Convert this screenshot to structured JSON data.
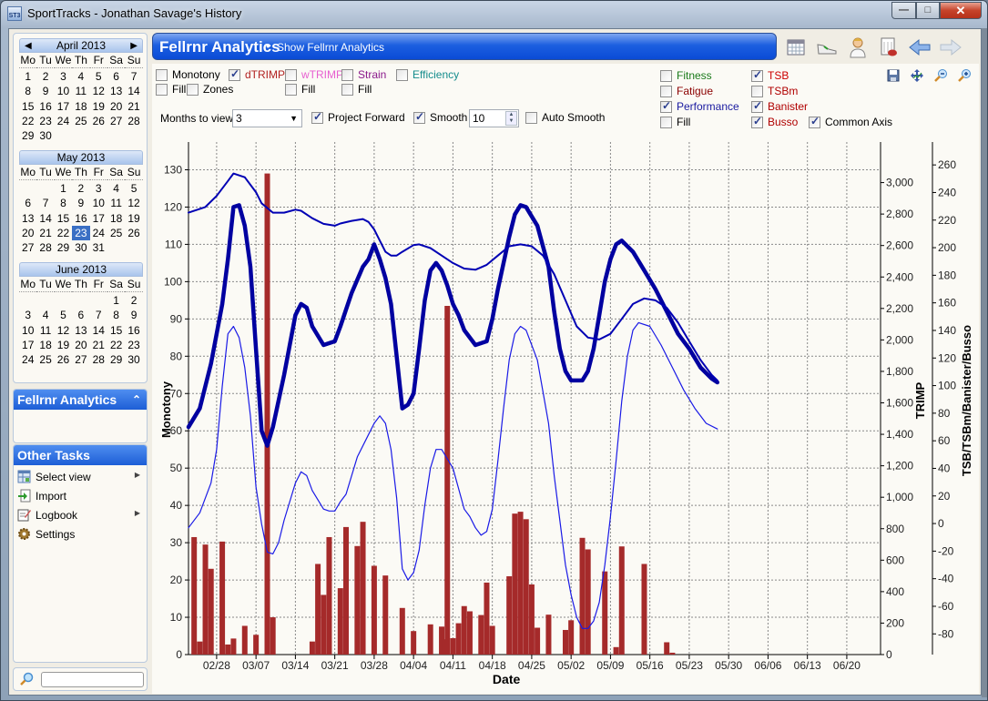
{
  "window": {
    "title": "SportTracks - Jonathan Savage's History",
    "app_icon_text": "ST3",
    "buttons": {
      "minimize": "—",
      "maximize": "□",
      "close": "✕"
    }
  },
  "calendars": [
    {
      "title": "April 2013",
      "nav_prev": "◀",
      "nav_next": "▶",
      "lead": 0,
      "days": 30,
      "selected": null
    },
    {
      "title": "May 2013",
      "lead": 2,
      "days": 31,
      "selected": 23
    },
    {
      "title": "June 2013",
      "lead": 5,
      "days": 30,
      "selected": null
    }
  ],
  "weekdays": [
    "Mo",
    "Tu",
    "We",
    "Th",
    "Fr",
    "Sa",
    "Su"
  ],
  "sidebar": {
    "analytics_panel": {
      "title": "Fellrnr Analytics",
      "collapse_icon": "«"
    },
    "other_tasks": {
      "title": "Other Tasks",
      "items": [
        {
          "label": "Select view",
          "icon": "select-view-icon",
          "submenu": true
        },
        {
          "label": "Import",
          "icon": "import-icon",
          "submenu": false
        },
        {
          "label": "Logbook",
          "icon": "logbook-icon",
          "submenu": true
        },
        {
          "label": "Settings",
          "icon": "gear-icon",
          "submenu": false
        }
      ]
    },
    "search": {
      "value": "",
      "placeholder": ""
    }
  },
  "header": {
    "title": "Fellrnr Analytics",
    "bullet": "•",
    "subtitle": "Show Fellrnr Analytics"
  },
  "toolbar_icons": [
    "calendar-icon",
    "shoe-icon",
    "athlete-icon",
    "report-icon",
    "back-arrow-icon",
    "forward-arrow-icon"
  ],
  "options": {
    "monotony": {
      "label": "Monotony",
      "checked": false
    },
    "monotony_fill": {
      "label": "Fill",
      "checked": false
    },
    "zones": {
      "label": "Zones",
      "checked": false
    },
    "dtrimp": {
      "label": "dTRIMP",
      "checked": true,
      "color": "#b22222"
    },
    "wtrimp": {
      "label": "wTRIMP",
      "checked": false,
      "color": "#e75fd0"
    },
    "wtrimp_fill": {
      "label": "Fill",
      "checked": false
    },
    "strain": {
      "label": "Strain",
      "checked": false,
      "color": "#8b1a8b"
    },
    "strain_fill": {
      "label": "Fill",
      "checked": false
    },
    "efficiency": {
      "label": "Efficiency",
      "checked": false,
      "color": "#148c8c"
    },
    "months_label": "Months to view",
    "months_value": "3",
    "project_forward": {
      "label": "Project Forward",
      "checked": true
    },
    "smooth": {
      "label": "Smooth",
      "checked": true
    },
    "smooth_value": "10",
    "auto_smooth": {
      "label": "Auto Smooth",
      "checked": false
    },
    "fitness": {
      "label": "Fitness",
      "checked": false,
      "color": "#1a7a1a"
    },
    "fatigue": {
      "label": "Fatigue",
      "checked": false,
      "color": "#8b0000"
    },
    "performance": {
      "label": "Performance",
      "checked": true,
      "color": "#1a1aa0"
    },
    "perf_fill": {
      "label": "Fill",
      "checked": false
    },
    "tsb": {
      "label": "TSB",
      "checked": true,
      "color": "#cc0000"
    },
    "tsbm": {
      "label": "TSBm",
      "checked": false,
      "color": "#b00000"
    },
    "banister": {
      "label": "Banister",
      "checked": true,
      "color": "#b00000"
    },
    "busso": {
      "label": "Busso",
      "checked": true,
      "color": "#b00000"
    },
    "common_axis": {
      "label": "Common Axis",
      "checked": true
    }
  },
  "chart_icons": [
    "save-icon",
    "fit-icon",
    "zoom-out-icon",
    "zoom-in-icon"
  ],
  "chart_data": {
    "type": "bar+line",
    "xlabel": "Date",
    "ylabel_left": "Monotony",
    "ylabel_right1": "TRIMP",
    "ylabel_right2": "TSB/TSBm/Banister/Busso",
    "x_ticks": [
      "02/28",
      "03/07",
      "03/14",
      "03/21",
      "03/28",
      "04/04",
      "04/11",
      "04/18",
      "04/25",
      "05/02",
      "05/09",
      "05/16",
      "05/23",
      "05/30",
      "06/06",
      "06/13",
      "06/20"
    ],
    "x_range_days": [
      -5,
      118
    ],
    "y_left": {
      "range": [
        0,
        135
      ],
      "ticks": [
        0,
        10,
        20,
        30,
        40,
        50,
        60,
        70,
        80,
        90,
        100,
        110,
        120,
        130
      ]
    },
    "y_trimp": {
      "range": [
        0,
        3200
      ],
      "ticks": [
        "0",
        "200",
        "400",
        "600",
        "800",
        "1,000",
        "1,200",
        "1,400",
        "1,600",
        "1,800",
        "2,000",
        "2,200",
        "2,400",
        "2,600",
        "2,800",
        "3,000"
      ]
    },
    "y_tsb": {
      "range": [
        -95,
        270
      ],
      "ticks": [
        "-80",
        "-60",
        "-40",
        "-20",
        "0",
        "20",
        "40",
        "60",
        "80",
        "100",
        "120",
        "140",
        "160",
        "180",
        "200",
        "220",
        "240",
        "260"
      ]
    },
    "grid": true,
    "dtrimp_bars": {
      "name": "dTRIMP",
      "color": "#a52a2a",
      "day": [
        -4,
        -3,
        -2,
        -1,
        1,
        2,
        3,
        5,
        7,
        9,
        10,
        17,
        18,
        19,
        20,
        22,
        23,
        25,
        26,
        28,
        30,
        33,
        35,
        38,
        40,
        40.5,
        41,
        42,
        43,
        44,
        45,
        47,
        48,
        49,
        52,
        53,
        54,
        55,
        56,
        57,
        59,
        62,
        63,
        65,
        66,
        69,
        71,
        72,
        76,
        80,
        81,
        82,
        83,
        84,
        85,
        86,
        87,
        88,
        89,
        90,
        91
      ],
      "monotony_value": [
        31.5,
        3.5,
        29.5,
        23,
        30.3,
        2.7,
        4.3,
        7.7,
        5.3,
        129,
        10,
        3.5,
        24.3,
        16,
        31.5,
        17.8,
        34.2,
        29.1,
        35.6,
        23.8,
        21.2,
        12.5,
        6.3,
        8.1,
        7.5,
        4.1,
        93.5,
        4.4,
        8.4,
        13,
        11.6,
        10.6,
        19.3,
        7.7,
        21,
        37.8,
        38.3,
        36.3,
        18.8,
        7.2,
        10.7,
        6.6,
        9.2,
        31.3,
        28.2,
        22.3,
        2,
        29,
        24.3,
        3.3,
        0.5,
        0,
        0,
        0,
        0,
        0,
        0,
        0,
        0,
        0,
        0
      ],
      "note": "values read on Monotony/common axis scale"
    },
    "series": [
      {
        "name": "Performance",
        "color": "#0000a0",
        "width": "thick",
        "points": [
          [
            -5,
            61
          ],
          [
            -3,
            66
          ],
          [
            -1,
            78
          ],
          [
            1,
            94
          ],
          [
            2,
            106
          ],
          [
            3,
            120
          ],
          [
            4,
            120.5
          ],
          [
            5,
            115
          ],
          [
            6,
            104
          ],
          [
            7,
            82
          ],
          [
            8,
            60
          ],
          [
            9,
            56
          ],
          [
            10,
            61
          ],
          [
            12,
            75
          ],
          [
            14,
            91
          ],
          [
            15,
            94
          ],
          [
            16,
            93
          ],
          [
            17,
            88
          ],
          [
            19,
            83
          ],
          [
            21,
            84
          ],
          [
            22,
            88
          ],
          [
            24,
            97
          ],
          [
            26,
            104
          ],
          [
            27,
            106
          ],
          [
            28,
            110
          ],
          [
            29,
            106
          ],
          [
            30,
            101
          ],
          [
            31,
            94
          ],
          [
            32,
            80
          ],
          [
            33,
            66
          ],
          [
            34,
            67
          ],
          [
            35,
            70
          ],
          [
            36,
            82
          ],
          [
            37,
            95
          ],
          [
            38,
            103
          ],
          [
            39,
            105
          ],
          [
            40,
            103
          ],
          [
            41,
            99
          ],
          [
            42,
            94
          ],
          [
            43,
            91
          ],
          [
            44,
            87
          ],
          [
            46,
            83
          ],
          [
            48,
            84
          ],
          [
            49,
            90
          ],
          [
            50,
            98
          ],
          [
            52,
            112
          ],
          [
            53,
            118
          ],
          [
            54,
            120.5
          ],
          [
            55,
            120
          ],
          [
            57,
            115
          ],
          [
            59,
            104
          ],
          [
            60,
            92
          ],
          [
            61,
            82
          ],
          [
            62,
            76
          ],
          [
            63,
            73.5
          ],
          [
            65,
            73.5
          ],
          [
            66,
            76
          ],
          [
            67,
            82
          ],
          [
            68,
            91
          ],
          [
            69,
            100
          ],
          [
            70,
            106
          ],
          [
            71,
            110
          ],
          [
            72,
            111
          ],
          [
            74,
            108
          ],
          [
            76,
            103
          ],
          [
            78,
            98
          ],
          [
            80,
            92
          ],
          [
            82,
            86
          ],
          [
            84,
            82
          ],
          [
            86,
            77
          ],
          [
            88,
            74
          ],
          [
            89,
            73
          ]
        ]
      },
      {
        "name": "TSB",
        "color": "#0000b4",
        "width": "medium",
        "points": [
          [
            -5,
            118.5
          ],
          [
            -2,
            120
          ],
          [
            0,
            123
          ],
          [
            2,
            127
          ],
          [
            3,
            129
          ],
          [
            5,
            128
          ],
          [
            7,
            124
          ],
          [
            8,
            121
          ],
          [
            10,
            118.5
          ],
          [
            12,
            118.5
          ],
          [
            14,
            119.3
          ],
          [
            15,
            119
          ],
          [
            17,
            117
          ],
          [
            19,
            115.5
          ],
          [
            21,
            115
          ],
          [
            22,
            115.6
          ],
          [
            24,
            116.3
          ],
          [
            26,
            116.8
          ],
          [
            27,
            116
          ],
          [
            28,
            114
          ],
          [
            29,
            111
          ],
          [
            30,
            108
          ],
          [
            31,
            107
          ],
          [
            32,
            107
          ],
          [
            33,
            108
          ],
          [
            35,
            109.8
          ],
          [
            36,
            110
          ],
          [
            38,
            109
          ],
          [
            40,
            107
          ],
          [
            42,
            105
          ],
          [
            44,
            103.5
          ],
          [
            46,
            103.2
          ],
          [
            48,
            104.5
          ],
          [
            50,
            107
          ],
          [
            52,
            109.5
          ],
          [
            54,
            110
          ],
          [
            56,
            109.5
          ],
          [
            58,
            107
          ],
          [
            60,
            102
          ],
          [
            62,
            95
          ],
          [
            64,
            88
          ],
          [
            66,
            85
          ],
          [
            68,
            84.5
          ],
          [
            70,
            86
          ],
          [
            72,
            90
          ],
          [
            74,
            94
          ],
          [
            76,
            95.5
          ],
          [
            78,
            95
          ],
          [
            80,
            93
          ],
          [
            82,
            89
          ],
          [
            84,
            84
          ],
          [
            86,
            79
          ],
          [
            88,
            75
          ],
          [
            89,
            73.5
          ]
        ]
      },
      {
        "name": "Banister/Busso",
        "color": "#1a1ae6",
        "width": "thin",
        "points": [
          [
            -5,
            34
          ],
          [
            -3,
            38
          ],
          [
            -1,
            46
          ],
          [
            0,
            55
          ],
          [
            1,
            72
          ],
          [
            2,
            86
          ],
          [
            3,
            88
          ],
          [
            4,
            85
          ],
          [
            5,
            77
          ],
          [
            6,
            64
          ],
          [
            7,
            45
          ],
          [
            8,
            35
          ],
          [
            9,
            27.5
          ],
          [
            10,
            27
          ],
          [
            11,
            30
          ],
          [
            12,
            36
          ],
          [
            14,
            46
          ],
          [
            15,
            49
          ],
          [
            16,
            48
          ],
          [
            17,
            44
          ],
          [
            19,
            39
          ],
          [
            20,
            38.5
          ],
          [
            21,
            38.5
          ],
          [
            22,
            41
          ],
          [
            23,
            43
          ],
          [
            25,
            53
          ],
          [
            27,
            59
          ],
          [
            28,
            62
          ],
          [
            29,
            64
          ],
          [
            30,
            62
          ],
          [
            31,
            55
          ],
          [
            32,
            42
          ],
          [
            33,
            23
          ],
          [
            34,
            20
          ],
          [
            35,
            22
          ],
          [
            36,
            28
          ],
          [
            37,
            40
          ],
          [
            38,
            50
          ],
          [
            39,
            55
          ],
          [
            40,
            55
          ],
          [
            42,
            50
          ],
          [
            44,
            39
          ],
          [
            45,
            37
          ],
          [
            46,
            34
          ],
          [
            47,
            32
          ],
          [
            48,
            33
          ],
          [
            49,
            39
          ],
          [
            50,
            52
          ],
          [
            51,
            66
          ],
          [
            52,
            79
          ],
          [
            53,
            86
          ],
          [
            54,
            88
          ],
          [
            55,
            87
          ],
          [
            57,
            79
          ],
          [
            59,
            62
          ],
          [
            60,
            48
          ],
          [
            61,
            36
          ],
          [
            62,
            24
          ],
          [
            63,
            16
          ],
          [
            64,
            10
          ],
          [
            65,
            7
          ],
          [
            66,
            7
          ],
          [
            67,
            9
          ],
          [
            68,
            14
          ],
          [
            69,
            24
          ],
          [
            70,
            37
          ],
          [
            71,
            52
          ],
          [
            72,
            68
          ],
          [
            73,
            80
          ],
          [
            74,
            87
          ],
          [
            75,
            89
          ],
          [
            77,
            88
          ],
          [
            79,
            83
          ],
          [
            81,
            77
          ],
          [
            83,
            71
          ],
          [
            85,
            66
          ],
          [
            87,
            62
          ],
          [
            89,
            60.5
          ]
        ]
      }
    ]
  }
}
